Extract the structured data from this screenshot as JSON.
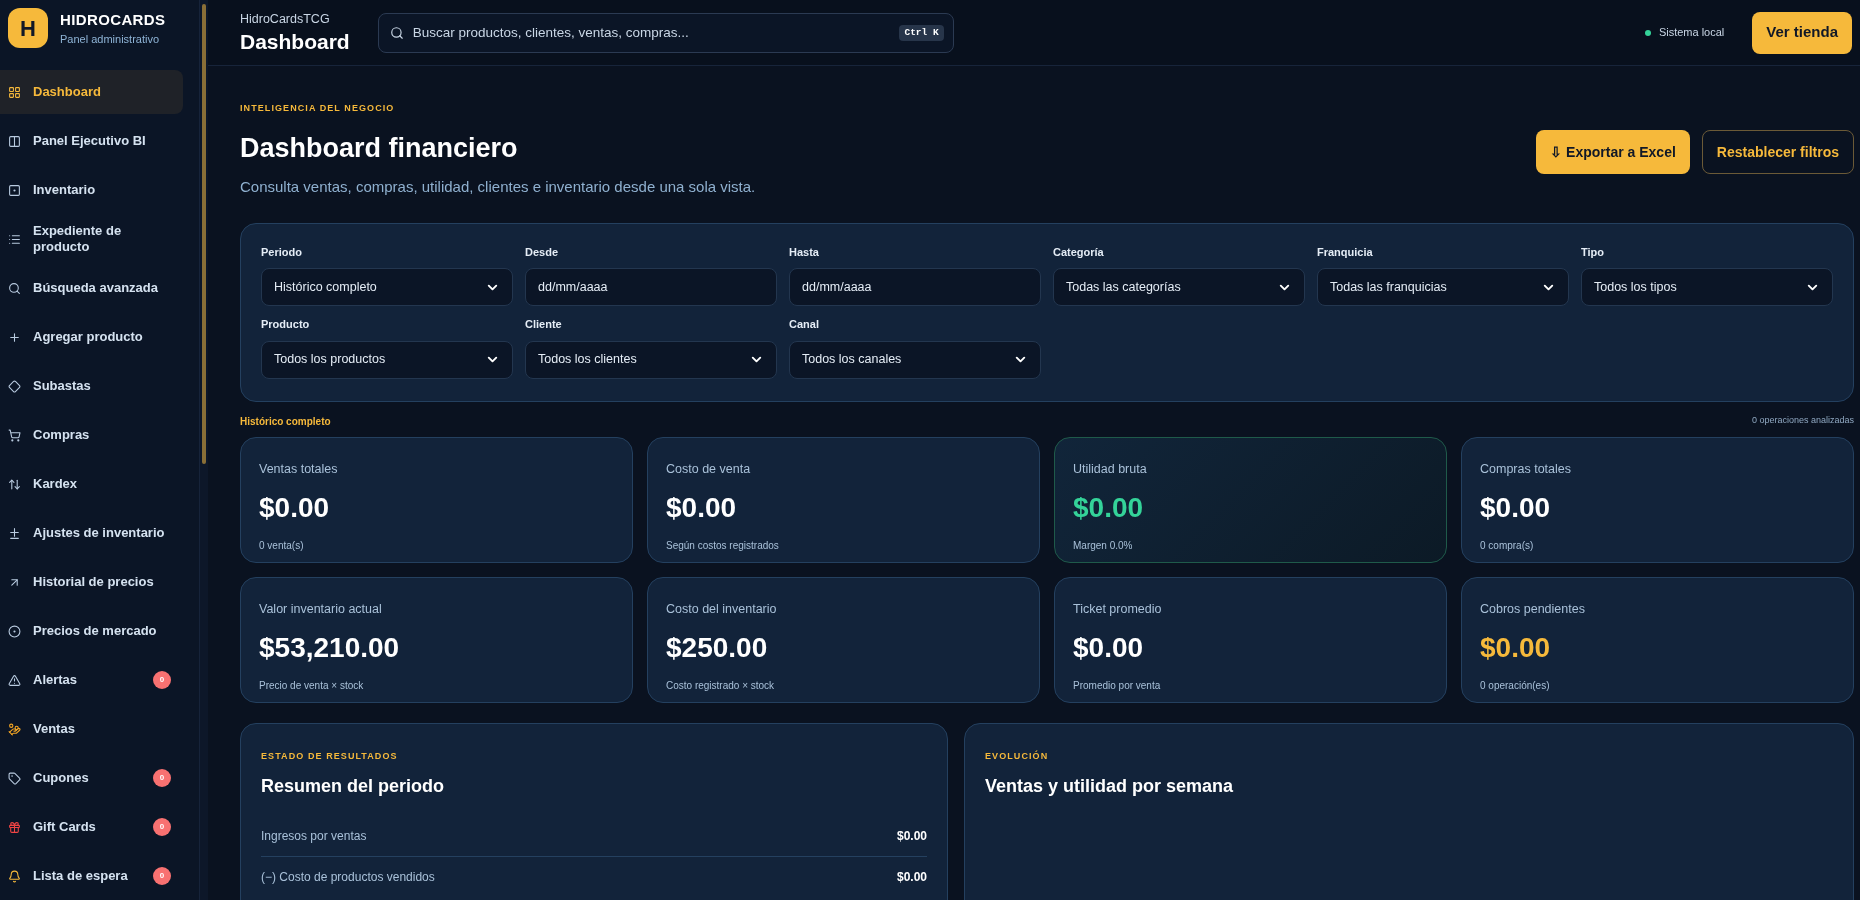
{
  "brand": {
    "logo": "H",
    "name": "HIDROCARDS",
    "subtitle": "Panel administrativo"
  },
  "sidebar": {
    "items": [
      {
        "label": "Dashboard",
        "selected": true
      },
      {
        "label": "Panel Ejecutivo BI",
        "selected": false
      },
      {
        "label": "Inventario",
        "selected": false
      },
      {
        "label": "Expediente de producto",
        "selected": false
      },
      {
        "label": "Búsqueda avanzada",
        "selected": false
      },
      {
        "label": "Agregar producto",
        "selected": false
      },
      {
        "label": "Subastas",
        "selected": false
      },
      {
        "label": "Compras",
        "selected": false
      },
      {
        "label": "Kardex",
        "selected": false
      },
      {
        "label": "Ajustes de inventario",
        "selected": false
      },
      {
        "label": "Historial de precios",
        "selected": false
      },
      {
        "label": "Precios de mercado",
        "selected": false
      },
      {
        "label": "Alertas",
        "selected": false,
        "badge": "0"
      },
      {
        "label": "Ventas",
        "selected": false
      },
      {
        "label": "Cupones",
        "selected": false,
        "badge": "0"
      },
      {
        "label": "Gift Cards",
        "selected": false,
        "badge": "0"
      },
      {
        "label": "Lista de espera",
        "selected": false,
        "badge": "0"
      }
    ]
  },
  "header": {
    "breadcrumb": "HidroCardsTCG",
    "title": "Dashboard",
    "search": {
      "placeholder": "Buscar productos, clientes, ventas, compras...",
      "shortcut": "Ctrl K"
    },
    "status": "Sistema local",
    "store_button": "Ver tienda"
  },
  "page": {
    "eyebrow": "INTELIGENCIA DEL NEGOCIO",
    "title": "Dashboard financiero",
    "subtitle": "Consulta ventas, compras, utilidad, clientes e inventario desde una sola vista.",
    "export_button": "⇩ Exportar a Excel",
    "reset_button": "Restablecer filtros"
  },
  "filters": [
    {
      "label": "Periodo",
      "kind": "select",
      "value": "Histórico completo"
    },
    {
      "label": "Desde",
      "kind": "date",
      "placeholder": "dd/mm/aaaa"
    },
    {
      "label": "Hasta",
      "kind": "date",
      "placeholder": "dd/mm/aaaa"
    },
    {
      "label": "Categoría",
      "kind": "select",
      "value": "Todas las categorías"
    },
    {
      "label": "Franquicia",
      "kind": "select",
      "value": "Todas las franquicias"
    },
    {
      "label": "Tipo",
      "kind": "select",
      "value": "Todos los tipos"
    },
    {
      "label": "Producto",
      "kind": "select",
      "value": "Todos los productos"
    },
    {
      "label": "Cliente",
      "kind": "select",
      "value": "Todos los clientes"
    },
    {
      "label": "Canal",
      "kind": "select",
      "value": "Todos los canales"
    }
  ],
  "summary_bar": {
    "period": "Histórico completo",
    "operations": "0 operaciones analizadas"
  },
  "kpis": [
    {
      "label": "Ventas totales",
      "value": "$0.00",
      "note": "0 venta(s)",
      "kind": "normal"
    },
    {
      "label": "Costo de venta",
      "value": "$0.00",
      "note": "Según costos registrados",
      "kind": "normal"
    },
    {
      "label": "Utilidad bruta",
      "value": "$0.00",
      "note": "Margen 0.0%",
      "kind": "positive"
    },
    {
      "label": "Compras totales",
      "value": "$0.00",
      "note": "0 compra(s)",
      "kind": "normal"
    },
    {
      "label": "Valor inventario actual",
      "value": "$53,210.00",
      "note": "Precio de venta × stock",
      "kind": "normal"
    },
    {
      "label": "Costo del inventario",
      "value": "$250.00",
      "note": "Costo registrado × stock",
      "kind": "normal"
    },
    {
      "label": "Ticket promedio",
      "value": "$0.00",
      "note": "Promedio por venta",
      "kind": "normal"
    },
    {
      "label": "Cobros pendientes",
      "value": "$0.00",
      "note": "0 operación(es)",
      "kind": "pending"
    }
  ],
  "income_statement": {
    "eyebrow": "ESTADO DE RESULTADOS",
    "title": "Resumen del periodo",
    "rows": [
      {
        "label": "Ingresos por ventas",
        "value": "$0.00"
      },
      {
        "label": "(−) Costo de productos vendidos",
        "value": "$0.00"
      }
    ]
  },
  "evolution": {
    "eyebrow": "EVOLUCIÓN",
    "title": "Ventas y utilidad por semana"
  }
}
